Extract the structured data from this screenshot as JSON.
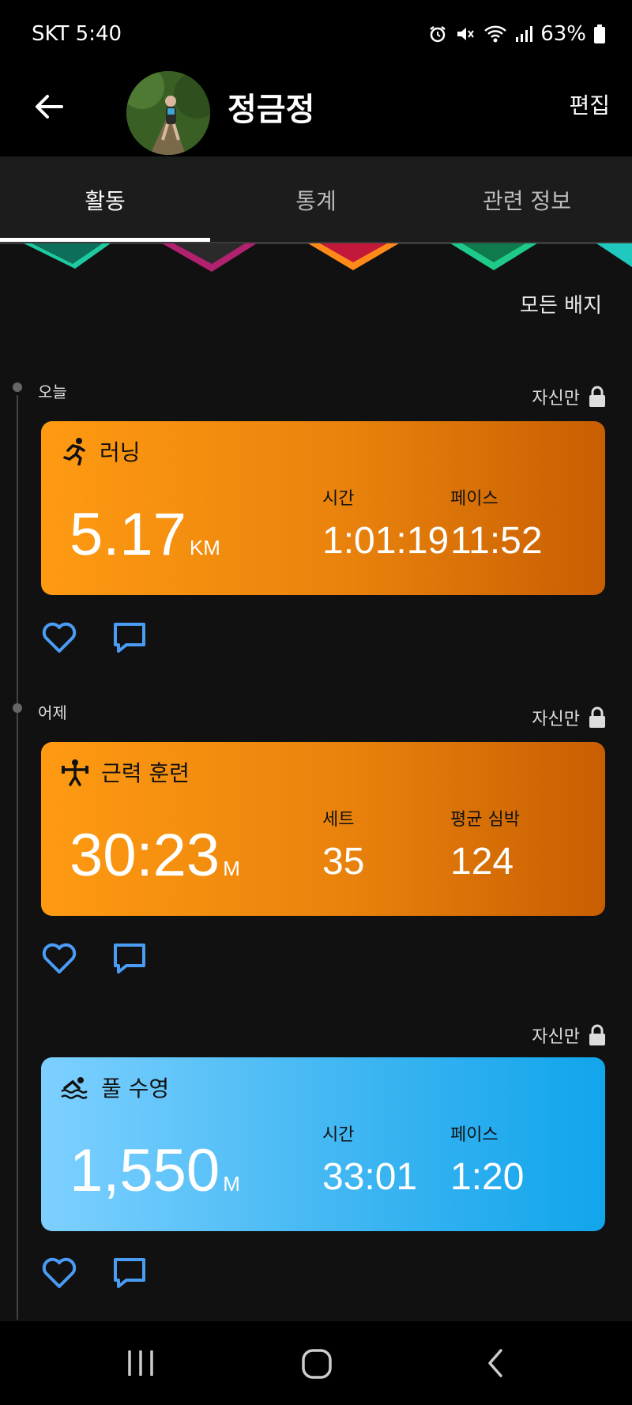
{
  "status_bar": {
    "carrier_time": "SKT 5:40",
    "battery": "63%"
  },
  "header": {
    "user_name": "정금정",
    "edit_label": "편집"
  },
  "tabs": [
    {
      "label": "활동",
      "active": true
    },
    {
      "label": "통계",
      "active": false
    },
    {
      "label": "관련 정보",
      "active": false
    }
  ],
  "badges": {
    "all_badges_label": "모든 배지"
  },
  "days": [
    {
      "label": "오늘"
    },
    {
      "label": "어제"
    }
  ],
  "privacy_label": "자신만",
  "activities": [
    {
      "type": "러닝",
      "icon": "running-icon",
      "main_value": "5.17",
      "main_unit": "KM",
      "stat1_label": "시간",
      "stat1_value": "1:01:19",
      "stat2_label": "페이스",
      "stat2_value": "11:52",
      "color": "#ff9a12"
    },
    {
      "type": "근력 훈련",
      "icon": "weightlifting-icon",
      "main_value": "30:23",
      "main_unit": "M",
      "stat1_label": "세트",
      "stat1_value": "35",
      "stat2_label": "평균 심박",
      "stat2_value": "124",
      "color": "#ff9a12"
    },
    {
      "type": "풀 수영",
      "icon": "swimming-icon",
      "main_value": "1,550",
      "main_unit": "M",
      "stat1_label": "시간",
      "stat1_value": "33:01",
      "stat2_label": "페이스",
      "stat2_value": "1:20",
      "color": "#3fb6f2"
    }
  ],
  "colors": {
    "like_icon": "#4a9cf5",
    "comment_icon": "#4a9cf5",
    "background": "#111111"
  }
}
